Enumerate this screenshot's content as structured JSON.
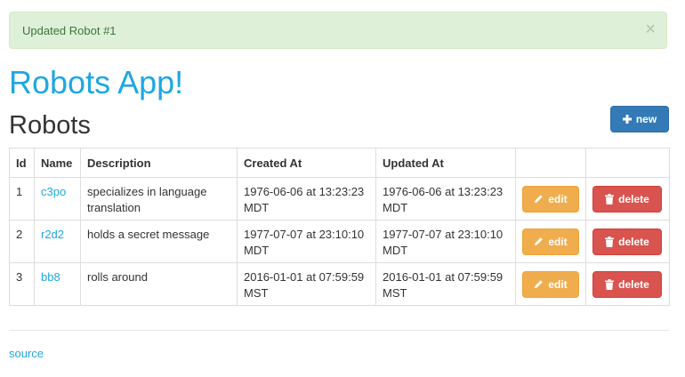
{
  "alert": {
    "message": "Updated Robot #1",
    "close_label": "×"
  },
  "app": {
    "title": "Robots App!"
  },
  "page": {
    "heading": "Robots",
    "new_label": "new"
  },
  "table": {
    "columns": [
      "Id",
      "Name",
      "Description",
      "Created At",
      "Updated At",
      "",
      ""
    ],
    "rows": [
      {
        "id": "1",
        "name": "c3po",
        "description": "specializes in language translation",
        "created_at": "1976-06-06 at 13:23:23 MDT",
        "updated_at": "1976-06-06 at 13:23:23 MDT"
      },
      {
        "id": "2",
        "name": "r2d2",
        "description": "holds a secret message",
        "created_at": "1977-07-07 at 23:10:10 MDT",
        "updated_at": "1977-07-07 at 23:10:10 MDT"
      },
      {
        "id": "3",
        "name": "bb8",
        "description": "rolls around",
        "created_at": "2016-01-01 at 07:59:59 MST",
        "updated_at": "2016-01-01 at 07:59:59 MST"
      }
    ],
    "edit_label": "edit",
    "delete_label": "delete"
  },
  "footer": {
    "source_label": "source"
  },
  "colors": {
    "link": "#1fa7e1",
    "primary": "#337ab7",
    "warning": "#f0ad4e",
    "danger": "#d9534f",
    "success_bg": "#dff0d8"
  },
  "icons": {
    "new": "plus-icon",
    "edit": "pencil-icon",
    "delete": "trash-icon",
    "close": "close-icon"
  }
}
